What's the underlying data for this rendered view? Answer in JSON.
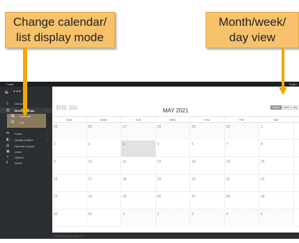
{
  "topbar": {
    "brand": "Fugen",
    "right": "Fugen"
  },
  "sidebar": {
    "items": [
      {
        "label": "Devices",
        "icon": "device-icon"
      },
      {
        "label": "Meter readings",
        "icon": "chart-icon",
        "caret": "+"
      },
      {
        "label": "Flows",
        "icon": "flow-icon",
        "caret": "+"
      },
      {
        "label": "Quality profiles",
        "icon": "quality-icon",
        "caret": "+"
      },
      {
        "label": "Remote Control",
        "icon": "remote-icon"
      },
      {
        "label": "Users",
        "icon": "users-icon"
      },
      {
        "label": "Upload",
        "icon": "upload-icon"
      },
      {
        "label": "About",
        "icon": "info-icon"
      }
    ],
    "sub_items": [
      {
        "label": "Calendar",
        "icon": "calendar-icon"
      },
      {
        "label": "List",
        "icon": "list-icon"
      }
    ]
  },
  "calendar": {
    "title": "MAY 2021",
    "prev": "‹",
    "next": "›",
    "today": "today",
    "views": [
      "month",
      "week",
      "day"
    ],
    "active_view": "month",
    "days_of_week": [
      "SUN",
      "MON",
      "TUE",
      "WED",
      "THU",
      "FRI",
      "SAT"
    ],
    "weeks": [
      [
        "25",
        "26",
        "27",
        "28",
        "29",
        "30",
        "1"
      ],
      [
        "2",
        "3",
        "4",
        "5",
        "6",
        "7",
        "8"
      ],
      [
        "9",
        "10",
        "11",
        "12",
        "13",
        "14",
        "15"
      ],
      [
        "16",
        "17",
        "18",
        "19",
        "20",
        "21",
        "22"
      ],
      [
        "23",
        "24",
        "25",
        "26",
        "27",
        "28",
        "29"
      ],
      [
        "30",
        "31",
        "1",
        "2",
        "3",
        "4",
        "5"
      ]
    ],
    "today_cell": "4"
  },
  "footer": {
    "text": "© All rights reserved. Fugen, s.a."
  },
  "callouts": {
    "left": [
      "Change calendar/",
      "list display mode"
    ],
    "right": [
      "Month/week/",
      "day view"
    ]
  },
  "colors": {
    "callout": "#f7c26b",
    "arrow": "#f2a900",
    "sidebar": "#2b2e33"
  }
}
